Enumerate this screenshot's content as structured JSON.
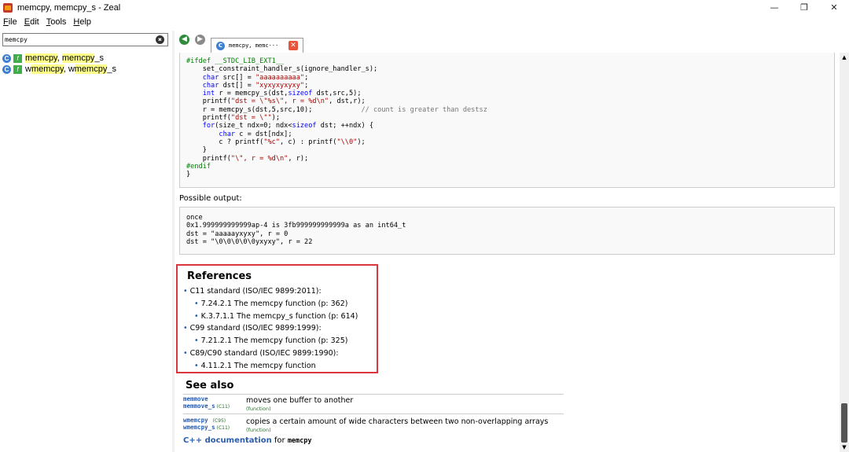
{
  "window": {
    "title": "memcpy, memcpy_s - Zeal",
    "minimize": "—",
    "maximize": "❐",
    "close": "✕"
  },
  "menu": {
    "file_ul": "F",
    "file_rest": "ile",
    "edit_ul": "E",
    "edit_rest": "dit",
    "tools_ul": "T",
    "tools_rest": "ools",
    "help_ul": "H",
    "help_rest": "elp"
  },
  "search": {
    "value": "memcpy",
    "clear_icon": "✖"
  },
  "results": [
    {
      "pre": "",
      "hl": "memcpy",
      "mid": ", ",
      "hl2": "memcpy",
      "post": "_s"
    },
    {
      "pre": "w",
      "hl": "memcpy",
      "mid": ", w",
      "hl2": "memcpy",
      "post": "_s"
    }
  ],
  "tab": {
    "label": "memcpy, memc···",
    "close": "✕",
    "back": "◀",
    "forward": "▶"
  },
  "code": {
    "l1a": "#ifdef __STDC_LIB_EXT1__",
    "l2": "    set_constraint_handler_s(ignore_handler_s);",
    "l3a": "    char",
    "l3b": " src[] = ",
    "l3c": "\"aaaaaaaaaa\"",
    "l3d": ";",
    "l4a": "    char",
    "l4b": " dst[] = ",
    "l4c": "\"xyxyxyxyxy\"",
    "l4d": ";",
    "l5a": "    int",
    "l5b": " r = memcpy_s(dst,",
    "l5c": "sizeof",
    "l5d": " dst,src,5);",
    "l6a": "    printf(",
    "l6b": "\"dst = \\\"%s\\\", r = %d\\n\"",
    "l6c": ", dst,r);",
    "l7a": "    r = memcpy_s(dst,5,src,10);",
    "l7b": "            // count is greater than destsz",
    "l8a": "    printf(",
    "l8b": "\"dst = \\\"\"",
    "l8c": ");",
    "l9a": "    for",
    "l9b": "(size_t ndx=0; ndx<",
    "l9c": "sizeof",
    "l9d": " dst; ++ndx) {",
    "l10a": "        char",
    "l10b": " c = dst[ndx];",
    "l11a": "        c ? printf(",
    "l11b": "\"%c\"",
    "l11c": ", c) : printf(",
    "l11d": "\"\\\\0\"",
    "l11e": ");",
    "l12": "    }",
    "l13a": "    printf(",
    "l13b": "\"\\\", r = %d\\n\"",
    "l13c": ", r);",
    "l14": "#endif",
    "l15": "}"
  },
  "output": {
    "label": "Possible output:",
    "lines": "once\n0x1.999999999999ap-4 is 3fb999999999999a as an int64_t\ndst = \"aaaaayxyxy\", r = 0\ndst = \"\\0\\0\\0\\0\\0yxyxy\", r = 22"
  },
  "references": {
    "title": "References",
    "items": [
      "C11 standard (ISO/IEC 9899:2011):",
      "7.24.2.1 The memcpy function (p: 362)",
      "K.3.7.1.1 The memcpy_s function (p: 614)",
      "C99 standard (ISO/IEC 9899:1999):",
      "7.21.2.1 The memcpy function (p: 325)",
      "C89/C90 standard (ISO/IEC 9899:1990):",
      "4.11.2.1 The memcpy function"
    ]
  },
  "see_also": {
    "title": "See also",
    "rows": [
      {
        "name1": "memmove",
        "name2": "memmove_s",
        "std2": "(C11)",
        "desc": "moves one buffer to another",
        "kind": "(function)"
      },
      {
        "name1": "wmemcpy",
        "std1": "(C95)",
        "name2": "wmemcpy_s",
        "std2": "(C11)",
        "desc": "copies a certain amount of wide characters between two non-overlapping arrays",
        "kind": "(function)"
      }
    ],
    "cpp_link": "C++ documentation",
    "cpp_for": " for ",
    "cpp_name": "memcpy"
  },
  "scrollbar": {
    "up": "▲",
    "down": "▼"
  }
}
